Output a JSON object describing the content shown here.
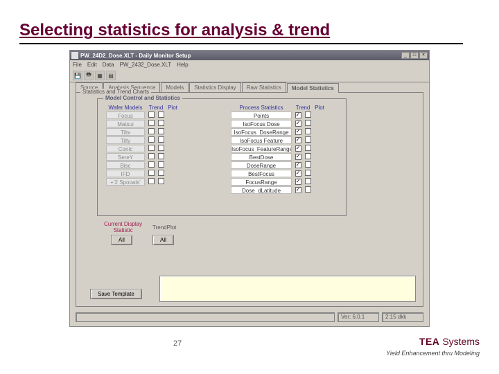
{
  "slide": {
    "title": "Selecting statistics for analysis & trend",
    "page_num": "27",
    "tea": {
      "brand": "TEA",
      "word": "Systems",
      "tagline": "Yield Enhancement thru Modeling"
    }
  },
  "win": {
    "title": "PW_24D2_Dose.XLT - Daily Monitor Setup",
    "menus": [
      "File",
      "Edit",
      "Data",
      "PW_2432_Dose.XLT",
      "Help"
    ],
    "tabs": [
      "Source",
      "Analysis Sequence",
      "Models",
      "Statistics Display",
      "Raw Statistics",
      "Model Statistics"
    ],
    "active_tab": 5,
    "panel_caption": "Statistics and Trend Charts",
    "group_caption": "Model Control and Statistics",
    "model_hdr": {
      "name": "Wafer Models",
      "trend": "Trend",
      "plot": "Plot"
    },
    "model_rows": [
      {
        "name": "Focus",
        "trend": false,
        "plot": false
      },
      {
        "name": "Matsui",
        "trend": false,
        "plot": false
      },
      {
        "name": "Tiltx",
        "trend": false,
        "plot": false
      },
      {
        "name": "Tilty",
        "trend": false,
        "plot": false
      },
      {
        "name": "Conic",
        "trend": false,
        "plot": false
      },
      {
        "name": "SereY",
        "trend": false,
        "plot": false
      },
      {
        "name": "Bisc",
        "trend": false,
        "plot": false
      },
      {
        "name": "IFD",
        "trend": false,
        "plot": false
      },
      {
        "name": "+'2 Spooals'",
        "trend": false,
        "plot": false
      }
    ],
    "proc_hdr": {
      "name": "Process Statistics",
      "trend": "Trend",
      "plot": "Plot"
    },
    "proc_rows": [
      {
        "name": "Points",
        "trend": true,
        "plot": false
      },
      {
        "name": "IsoFocus Dose",
        "trend": true,
        "plot": false
      },
      {
        "name": "IsoFocus_DoseRange",
        "trend": true,
        "plot": false
      },
      {
        "name": "IsoFocus Feature",
        "trend": true,
        "plot": false
      },
      {
        "name": "IsoFocus_FeatureRange",
        "trend": true,
        "plot": false
      },
      {
        "name": "BestDose",
        "trend": true,
        "plot": false
      },
      {
        "name": "DoseRange",
        "trend": true,
        "plot": false
      },
      {
        "name": "BestFocus",
        "trend": true,
        "plot": false
      },
      {
        "name": "FocusRange",
        "trend": true,
        "plot": false
      },
      {
        "name": "Dose_dLatitude",
        "trend": true,
        "plot": false
      }
    ],
    "disp": {
      "label1": "Current Display",
      "label2": "Statistic",
      "trendplot": "TrendPlot",
      "all_a": "All",
      "all_b": "All"
    },
    "save": "Save Template",
    "status_a": "Ver: 6.0.1",
    "status_b": "2:15 dkk"
  }
}
